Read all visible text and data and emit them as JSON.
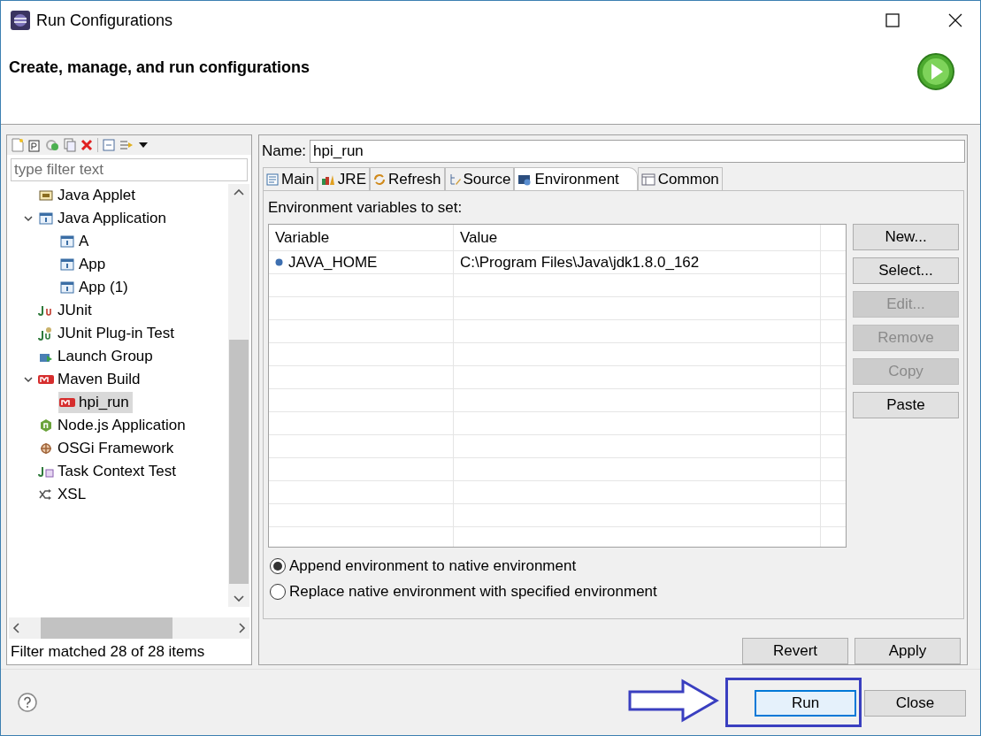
{
  "window": {
    "title": "Run Configurations"
  },
  "header": {
    "title": "Create, manage, and run configurations"
  },
  "sidebar": {
    "filter": {
      "placeholder": "type filter text"
    },
    "items": [
      {
        "label": "Java Applet",
        "kind": "applet",
        "selected": false
      },
      {
        "label": "Java Application",
        "kind": "app",
        "selected": false,
        "expanded": true,
        "children": [
          {
            "label": "A",
            "kind": "app",
            "selected": false
          },
          {
            "label": "App",
            "kind": "app",
            "selected": false
          },
          {
            "label": "App (1)",
            "kind": "app",
            "selected": false
          }
        ]
      },
      {
        "label": "JUnit",
        "kind": "junit",
        "selected": false
      },
      {
        "label": "JUnit Plug-in Test",
        "kind": "junit-plugin",
        "selected": false
      },
      {
        "label": "Launch Group",
        "kind": "group",
        "selected": false
      },
      {
        "label": "Maven Build",
        "kind": "maven",
        "selected": false,
        "expanded": true,
        "children": [
          {
            "label": "hpi_run",
            "kind": "maven",
            "selected": true
          }
        ]
      },
      {
        "label": "Node.js Application",
        "kind": "node",
        "selected": false
      },
      {
        "label": "OSGi Framework",
        "kind": "osgi",
        "selected": false
      },
      {
        "label": "Task Context Test",
        "kind": "task",
        "selected": false
      },
      {
        "label": "XSL",
        "kind": "xsl",
        "selected": false
      }
    ],
    "status": "Filter matched 28 of 28 items"
  },
  "name_field": {
    "label": "Name:",
    "value": "hpi_run"
  },
  "tabs": [
    {
      "label": "Main",
      "kind": "main",
      "selected": false
    },
    {
      "label": "JRE",
      "kind": "jre",
      "selected": false
    },
    {
      "label": "Refresh",
      "kind": "refresh",
      "selected": false
    },
    {
      "label": "Source",
      "kind": "source",
      "selected": false
    },
    {
      "label": "Environment",
      "kind": "env",
      "selected": true
    },
    {
      "label": "Common",
      "kind": "common",
      "selected": false
    }
  ],
  "environment": {
    "label": "Environment variables to set:",
    "table": {
      "columns": [
        "Variable",
        "Value"
      ],
      "rows": [
        [
          "JAVA_HOME",
          "C:\\Program Files\\Java\\jdk1.8.0_162"
        ]
      ]
    },
    "buttons": [
      {
        "label": "New...",
        "disabled": false
      },
      {
        "label": "Select...",
        "disabled": false
      },
      {
        "label": "Edit...",
        "disabled": true
      },
      {
        "label": "Remove",
        "disabled": true
      },
      {
        "label": "Copy",
        "disabled": true
      },
      {
        "label": "Paste",
        "disabled": false
      }
    ],
    "options": [
      {
        "label": "Append environment to native environment",
        "selected": true
      },
      {
        "label": "Replace native environment with specified environment",
        "selected": false
      }
    ]
  },
  "form_buttons": [
    "Revert",
    "Apply"
  ],
  "dialog_buttons": [
    {
      "label": "Run",
      "default": true
    },
    {
      "label": "Close",
      "default": false
    }
  ]
}
